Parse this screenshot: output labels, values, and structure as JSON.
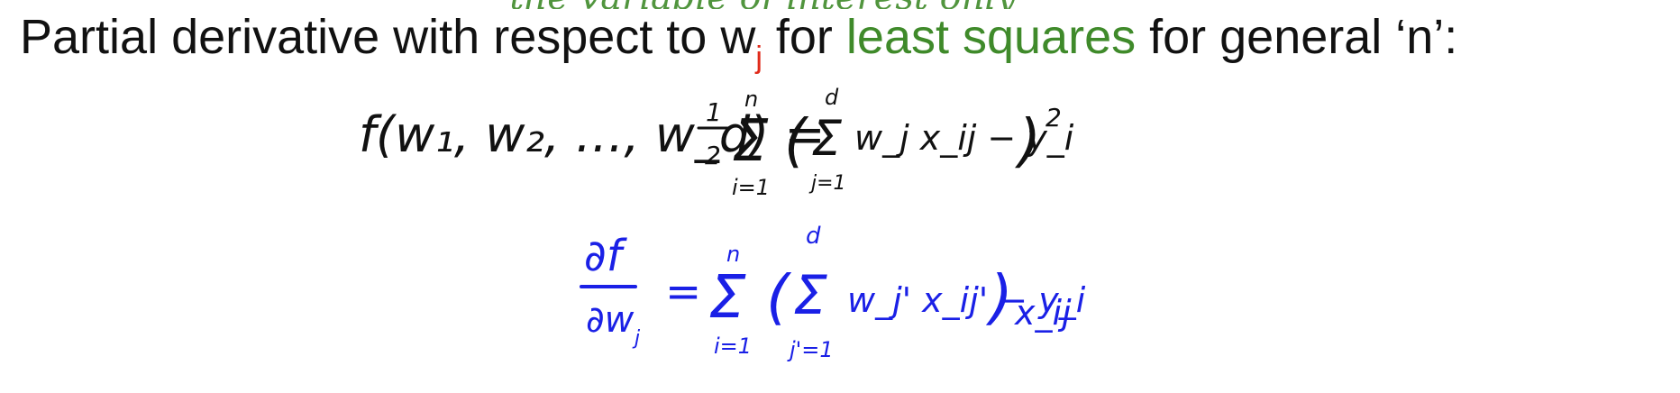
{
  "slide": {
    "top_remnant_text": "· the variable of interest only",
    "heading": {
      "prefix": "Partial derivative with respect to w",
      "subscript": "j",
      "middle": " for ",
      "highlight": "least squares",
      "suffix": " for general ‘n’:"
    },
    "colors": {
      "heading_text": "#111111",
      "subscript": "#e02a1a",
      "highlight": "#3f8a2a",
      "equation1_ink": "#111111",
      "equation2_ink": "#1a20e6"
    },
    "equation1": {
      "lhs": "f(w₁, w₂, …, w_d) =",
      "half": "1/2",
      "outer_sum_top": "n",
      "outer_sum_bottom": "i=1",
      "inner_sum_top": "d",
      "inner_sum_bottom": "j=1",
      "body": "w_j x_ij − y_i",
      "power": "2"
    },
    "equation2": {
      "lhs": "∂f / ∂w_j",
      "equals": "=",
      "outer_sum_top": "n",
      "outer_sum_bottom": "i=1",
      "inner_sum_top": "d",
      "inner_sum_bottom": "j'=1",
      "body": "w_j' x_ij' − y_i",
      "trailing": "x_ij"
    }
  }
}
